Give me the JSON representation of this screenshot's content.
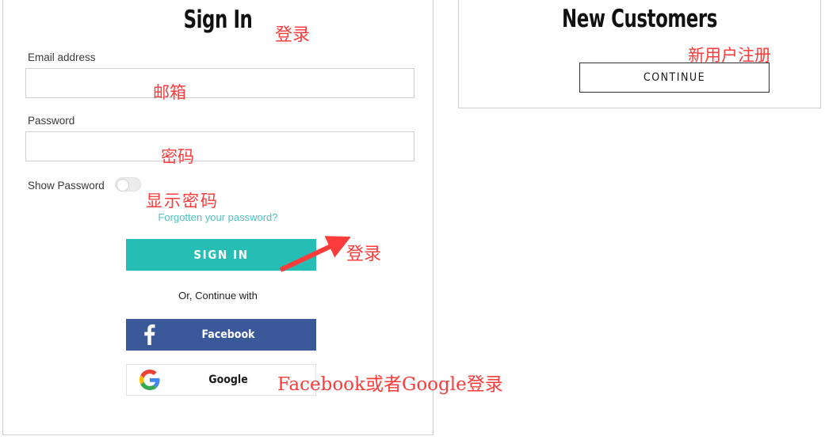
{
  "signin": {
    "title": "Sign In",
    "email_label": "Email address",
    "email_value": "",
    "email_placeholder": "",
    "password_label": "Password",
    "password_value": "",
    "password_placeholder": "",
    "show_password_label": "Show Password",
    "show_password_state": "off",
    "forgot_link": "Forgotten your password?",
    "submit_label": "SIGN IN",
    "or_continue": "Or, Continue with",
    "facebook_label": "Facebook",
    "google_label": "Google",
    "accent_color": "#26bdb5",
    "link_color": "#4cc3c1",
    "facebook_color": "#3b5998"
  },
  "new_customers": {
    "title": "New Customers",
    "continue_label": "CONTINUE"
  },
  "annotations": {
    "color": "#fc3b3b",
    "signin_title": "登录",
    "email": "邮箱",
    "password": "密码",
    "show_password": "显示密码",
    "signin_button": "登录",
    "social": "Facebook或者Google登录",
    "new_customers": "新用户注册"
  }
}
